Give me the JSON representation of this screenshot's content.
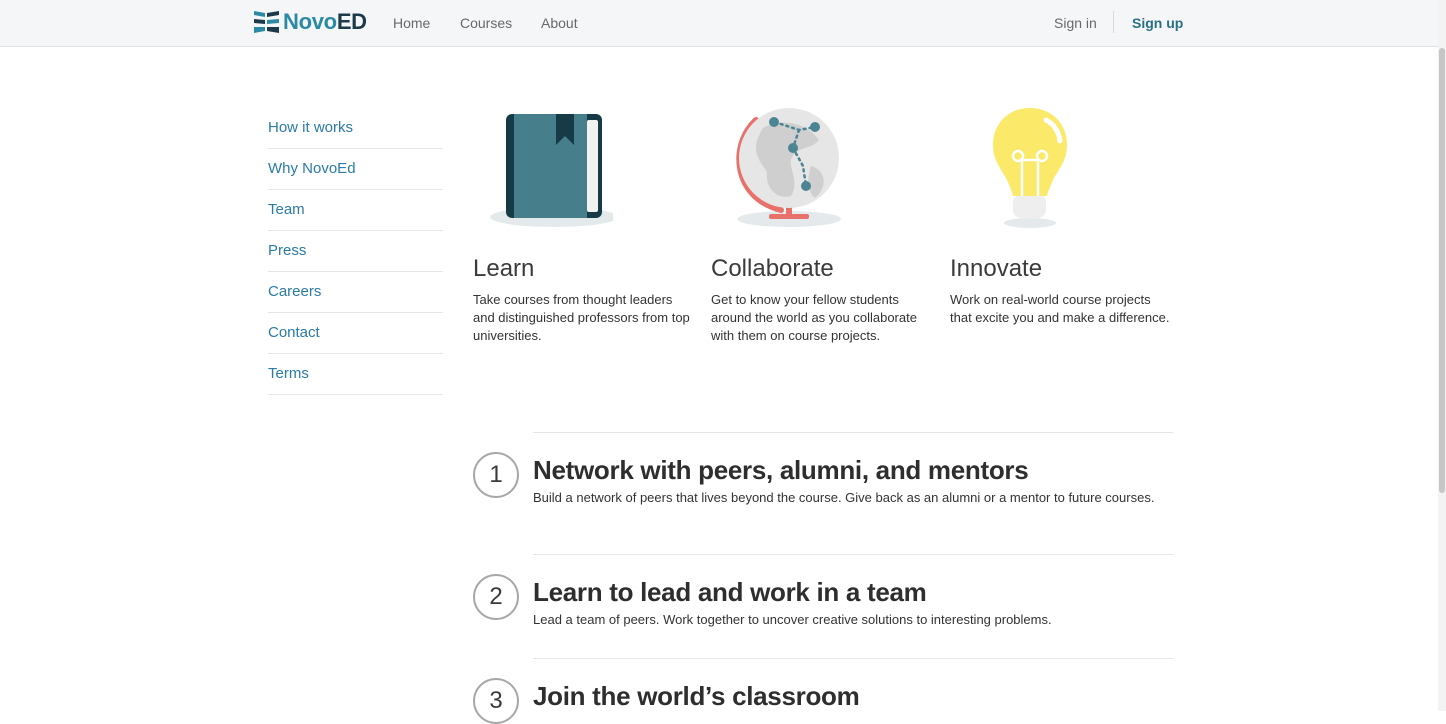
{
  "header": {
    "logo_text_1": "Novo",
    "logo_text_2": "ED",
    "nav": [
      "Home",
      "Courses",
      "About"
    ],
    "sign_in": "Sign in",
    "sign_up": "Sign up"
  },
  "sidebar": {
    "items": [
      "How it works",
      "Why NovoEd",
      "Team",
      "Press",
      "Careers",
      "Contact",
      "Terms"
    ]
  },
  "features": [
    {
      "title": "Learn",
      "text": "Take courses from thought leaders and distinguished professors from top universities.",
      "icon": "book-icon"
    },
    {
      "title": "Collaborate",
      "text": "Get to know your fellow students around the world as you collaborate with them on course projects.",
      "icon": "globe-icon"
    },
    {
      "title": "Innovate",
      "text": "Work on real-world course projects that excite you and make a difference.",
      "icon": "lightbulb-icon"
    }
  ],
  "steps": [
    {
      "number": "1",
      "title": "Network with peers, alumni, and mentors",
      "text": "Build a network of peers that lives beyond the course. Give back as an alumni or a mentor to future courses."
    },
    {
      "number": "2",
      "title": "Learn to lead and work in a team",
      "text": "Lead a team of peers. Work together to uncover creative solutions to interesting problems."
    },
    {
      "number": "3",
      "title": "Join the world’s classroom",
      "text": ""
    }
  ],
  "colors": {
    "link": "#2a7ba8",
    "brand_primary": "#2c8aa5",
    "brand_dark": "#1d3a4b",
    "book": "#467e8c",
    "globe_stand": "#e8726b",
    "bulb": "#fbe96a"
  }
}
